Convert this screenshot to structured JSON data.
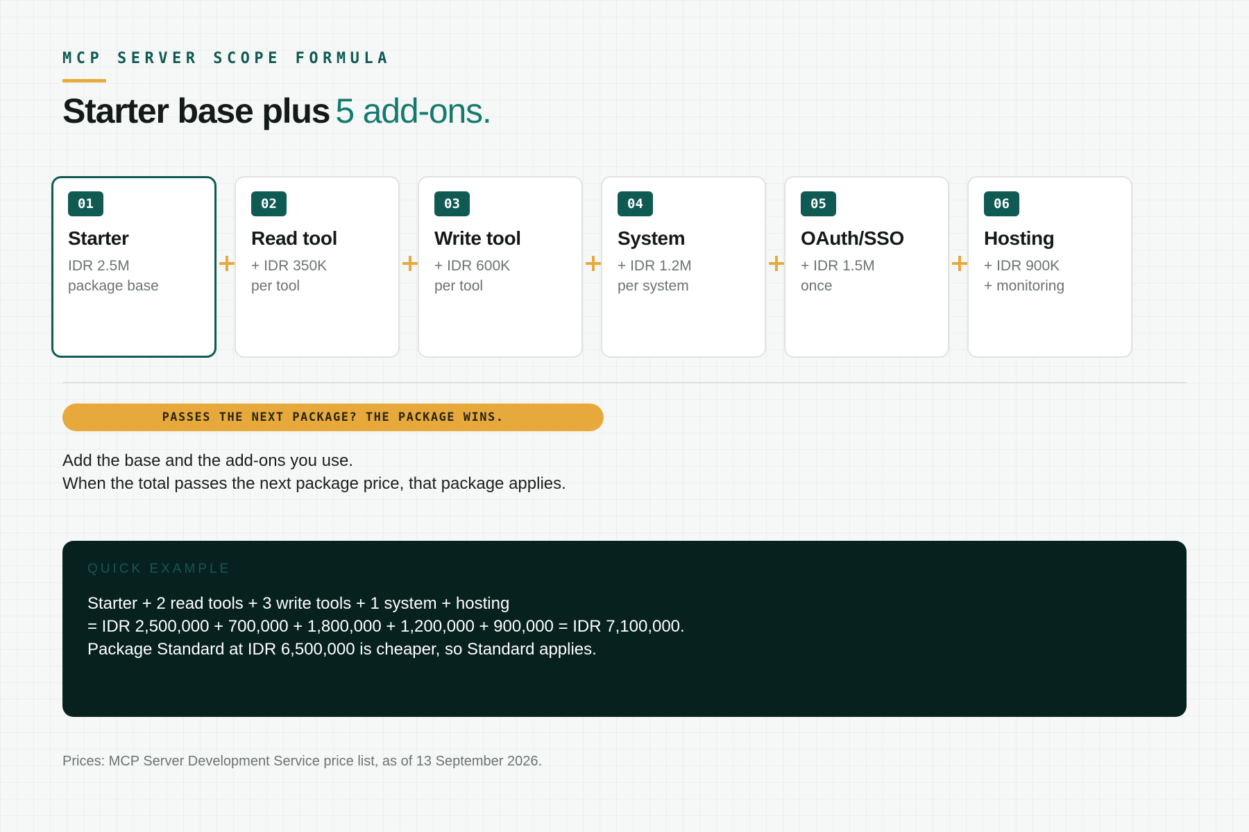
{
  "eyebrow": "MCP SERVER SCOPE FORMULA",
  "headline": {
    "strong": "Starter base plus",
    "accent": "5 add-ons."
  },
  "cards": [
    {
      "num": "01",
      "title": "Starter",
      "line1": "IDR 2.5M",
      "line2": "package base"
    },
    {
      "num": "02",
      "title": "Read tool",
      "line1": "+ IDR 350K",
      "line2": "per tool"
    },
    {
      "num": "03",
      "title": "Write tool",
      "line1": "+ IDR 600K",
      "line2": "per tool"
    },
    {
      "num": "04",
      "title": "System",
      "line1": "+ IDR 1.2M",
      "line2": "per system"
    },
    {
      "num": "05",
      "title": "OAuth/SSO",
      "line1": "+ IDR 1.5M",
      "line2": "once"
    },
    {
      "num": "06",
      "title": "Hosting",
      "line1": "+ IDR 900K",
      "line2": "+ monitoring"
    }
  ],
  "rule_pill": "PASSES THE NEXT PACKAGE? THE PACKAGE WINS.",
  "description": [
    "Add the base and the add-ons you use.",
    "When the total passes the next package price, that package applies."
  ],
  "example": {
    "label": "QUICK EXAMPLE",
    "lines": [
      "Starter + 2 read tools + 3 write tools + 1 system + hosting",
      "= IDR 2,500,000 + 700,000 + 1,800,000 + 1,200,000 + 900,000 = IDR 7,100,000.",
      "Package Standard at IDR 6,500,000 is cheaper, so Standard applies."
    ]
  },
  "footnote": "Prices: MCP Server Development Service price list, as of 13 September 2026.",
  "colors": {
    "brand_green": "#0f5a52",
    "accent_green": "#157a6e",
    "accent_amber": "#e7a93c",
    "panel_dark": "#07211f"
  }
}
